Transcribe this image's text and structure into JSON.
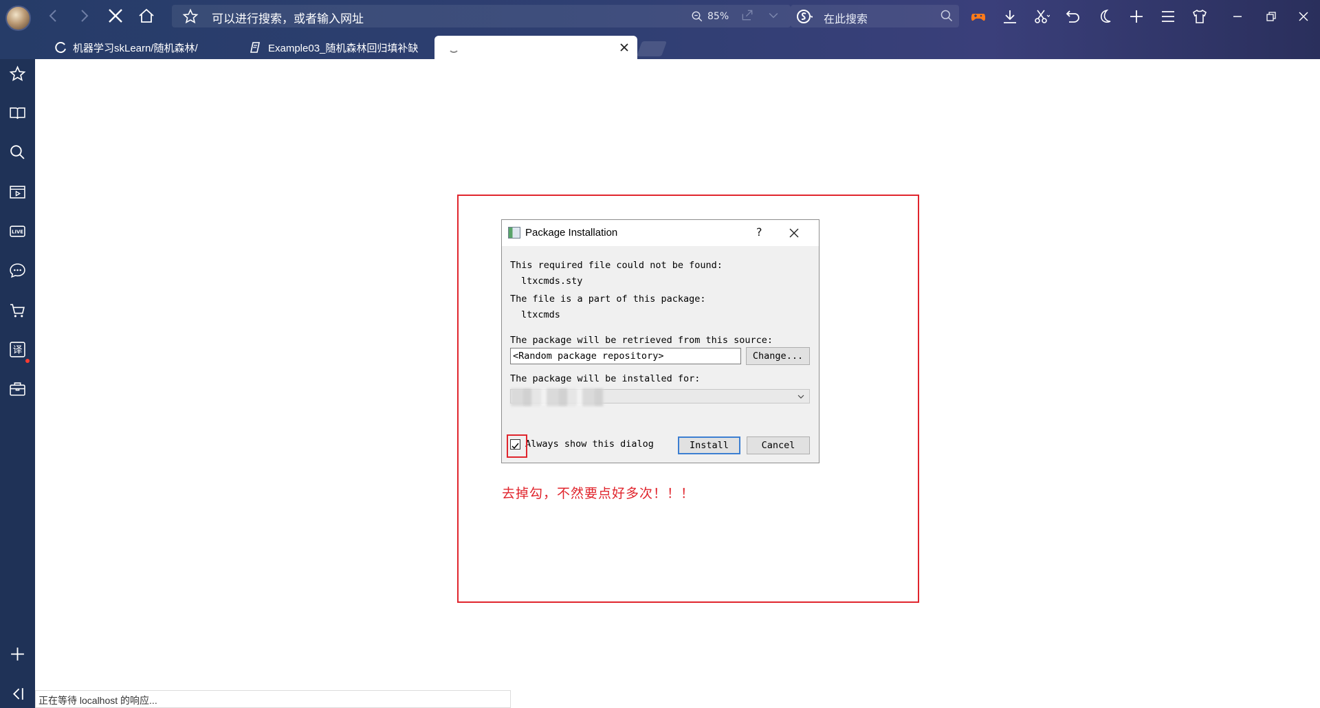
{
  "browser": {
    "address_placeholder": "可以进行搜索，或者输入网址",
    "zoom": "85%",
    "search_placeholder": "在此搜索"
  },
  "tabs": [
    {
      "label": "机器学习skLearn/随机森林/"
    },
    {
      "label": "Example03_随机森林回归填补缺"
    },
    {
      "label": ""
    }
  ],
  "dialog": {
    "title": "Package Installation",
    "help": "?",
    "line1": "This required file could not be found:",
    "file": "ltxcmds.sty",
    "line2": "The file is a part of this package:",
    "package": "ltxcmds",
    "line3": "The package will be retrieved from this source:",
    "source_value": "<Random package repository>",
    "change_label": "Change...",
    "line4": "The package will be installed for:",
    "checkbox_label": "Always show this dialog",
    "checkbox_checked": true,
    "install_label": "Install",
    "cancel_label": "Cancel"
  },
  "annotation": {
    "text": "去掉勾，不然要点好多次！！！",
    "color": "#e0242c"
  },
  "status": {
    "text": "正在等待 localhost 的响应..."
  },
  "icons": {
    "sidebar": [
      "star-icon",
      "book-icon",
      "search-icon",
      "video-icon",
      "live-icon",
      "chat-icon",
      "cart-icon",
      "translate-icon",
      "briefcase-icon",
      "plus-icon",
      "collapse-icon"
    ],
    "toolbar": [
      "game-icon",
      "download-icon",
      "scissors-icon",
      "undo-icon",
      "moon-icon",
      "plus-icon",
      "menu-icon",
      "shirt-icon"
    ]
  },
  "colors": {
    "chrome_bg": "#2f3f72",
    "sidebar_bg": "#1f3257",
    "annotation_red": "#e0242c",
    "default_button_border": "#3b7ed1"
  }
}
